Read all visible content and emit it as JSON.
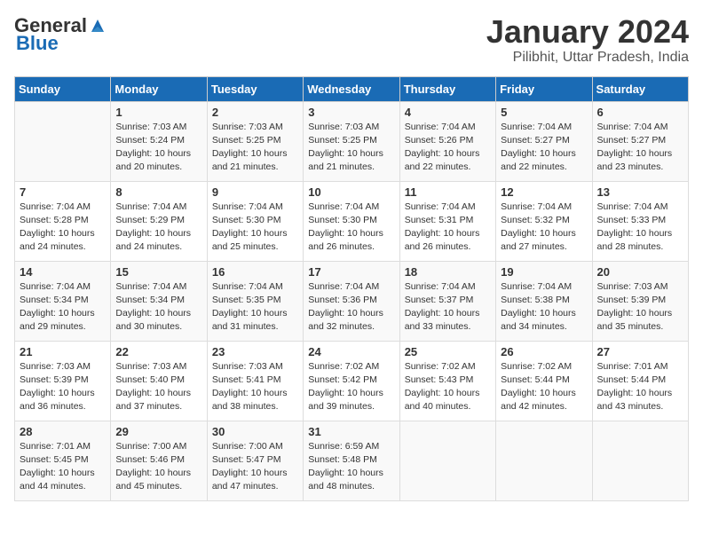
{
  "logo": {
    "text_general": "General",
    "text_blue": "Blue"
  },
  "title": {
    "month_year": "January 2024",
    "location": "Pilibhit, Uttar Pradesh, India"
  },
  "days_of_week": [
    "Sunday",
    "Monday",
    "Tuesday",
    "Wednesday",
    "Thursday",
    "Friday",
    "Saturday"
  ],
  "weeks": [
    [
      {
        "day": "",
        "info": ""
      },
      {
        "day": "1",
        "info": "Sunrise: 7:03 AM\nSunset: 5:24 PM\nDaylight: 10 hours\nand 20 minutes."
      },
      {
        "day": "2",
        "info": "Sunrise: 7:03 AM\nSunset: 5:25 PM\nDaylight: 10 hours\nand 21 minutes."
      },
      {
        "day": "3",
        "info": "Sunrise: 7:03 AM\nSunset: 5:25 PM\nDaylight: 10 hours\nand 21 minutes."
      },
      {
        "day": "4",
        "info": "Sunrise: 7:04 AM\nSunset: 5:26 PM\nDaylight: 10 hours\nand 22 minutes."
      },
      {
        "day": "5",
        "info": "Sunrise: 7:04 AM\nSunset: 5:27 PM\nDaylight: 10 hours\nand 22 minutes."
      },
      {
        "day": "6",
        "info": "Sunrise: 7:04 AM\nSunset: 5:27 PM\nDaylight: 10 hours\nand 23 minutes."
      }
    ],
    [
      {
        "day": "7",
        "info": "Sunrise: 7:04 AM\nSunset: 5:28 PM\nDaylight: 10 hours\nand 24 minutes."
      },
      {
        "day": "8",
        "info": "Sunrise: 7:04 AM\nSunset: 5:29 PM\nDaylight: 10 hours\nand 24 minutes."
      },
      {
        "day": "9",
        "info": "Sunrise: 7:04 AM\nSunset: 5:30 PM\nDaylight: 10 hours\nand 25 minutes."
      },
      {
        "day": "10",
        "info": "Sunrise: 7:04 AM\nSunset: 5:30 PM\nDaylight: 10 hours\nand 26 minutes."
      },
      {
        "day": "11",
        "info": "Sunrise: 7:04 AM\nSunset: 5:31 PM\nDaylight: 10 hours\nand 26 minutes."
      },
      {
        "day": "12",
        "info": "Sunrise: 7:04 AM\nSunset: 5:32 PM\nDaylight: 10 hours\nand 27 minutes."
      },
      {
        "day": "13",
        "info": "Sunrise: 7:04 AM\nSunset: 5:33 PM\nDaylight: 10 hours\nand 28 minutes."
      }
    ],
    [
      {
        "day": "14",
        "info": "Sunrise: 7:04 AM\nSunset: 5:34 PM\nDaylight: 10 hours\nand 29 minutes."
      },
      {
        "day": "15",
        "info": "Sunrise: 7:04 AM\nSunset: 5:34 PM\nDaylight: 10 hours\nand 30 minutes."
      },
      {
        "day": "16",
        "info": "Sunrise: 7:04 AM\nSunset: 5:35 PM\nDaylight: 10 hours\nand 31 minutes."
      },
      {
        "day": "17",
        "info": "Sunrise: 7:04 AM\nSunset: 5:36 PM\nDaylight: 10 hours\nand 32 minutes."
      },
      {
        "day": "18",
        "info": "Sunrise: 7:04 AM\nSunset: 5:37 PM\nDaylight: 10 hours\nand 33 minutes."
      },
      {
        "day": "19",
        "info": "Sunrise: 7:04 AM\nSunset: 5:38 PM\nDaylight: 10 hours\nand 34 minutes."
      },
      {
        "day": "20",
        "info": "Sunrise: 7:03 AM\nSunset: 5:39 PM\nDaylight: 10 hours\nand 35 minutes."
      }
    ],
    [
      {
        "day": "21",
        "info": "Sunrise: 7:03 AM\nSunset: 5:39 PM\nDaylight: 10 hours\nand 36 minutes."
      },
      {
        "day": "22",
        "info": "Sunrise: 7:03 AM\nSunset: 5:40 PM\nDaylight: 10 hours\nand 37 minutes."
      },
      {
        "day": "23",
        "info": "Sunrise: 7:03 AM\nSunset: 5:41 PM\nDaylight: 10 hours\nand 38 minutes."
      },
      {
        "day": "24",
        "info": "Sunrise: 7:02 AM\nSunset: 5:42 PM\nDaylight: 10 hours\nand 39 minutes."
      },
      {
        "day": "25",
        "info": "Sunrise: 7:02 AM\nSunset: 5:43 PM\nDaylight: 10 hours\nand 40 minutes."
      },
      {
        "day": "26",
        "info": "Sunrise: 7:02 AM\nSunset: 5:44 PM\nDaylight: 10 hours\nand 42 minutes."
      },
      {
        "day": "27",
        "info": "Sunrise: 7:01 AM\nSunset: 5:44 PM\nDaylight: 10 hours\nand 43 minutes."
      }
    ],
    [
      {
        "day": "28",
        "info": "Sunrise: 7:01 AM\nSunset: 5:45 PM\nDaylight: 10 hours\nand 44 minutes."
      },
      {
        "day": "29",
        "info": "Sunrise: 7:00 AM\nSunset: 5:46 PM\nDaylight: 10 hours\nand 45 minutes."
      },
      {
        "day": "30",
        "info": "Sunrise: 7:00 AM\nSunset: 5:47 PM\nDaylight: 10 hours\nand 47 minutes."
      },
      {
        "day": "31",
        "info": "Sunrise: 6:59 AM\nSunset: 5:48 PM\nDaylight: 10 hours\nand 48 minutes."
      },
      {
        "day": "",
        "info": ""
      },
      {
        "day": "",
        "info": ""
      },
      {
        "day": "",
        "info": ""
      }
    ]
  ]
}
